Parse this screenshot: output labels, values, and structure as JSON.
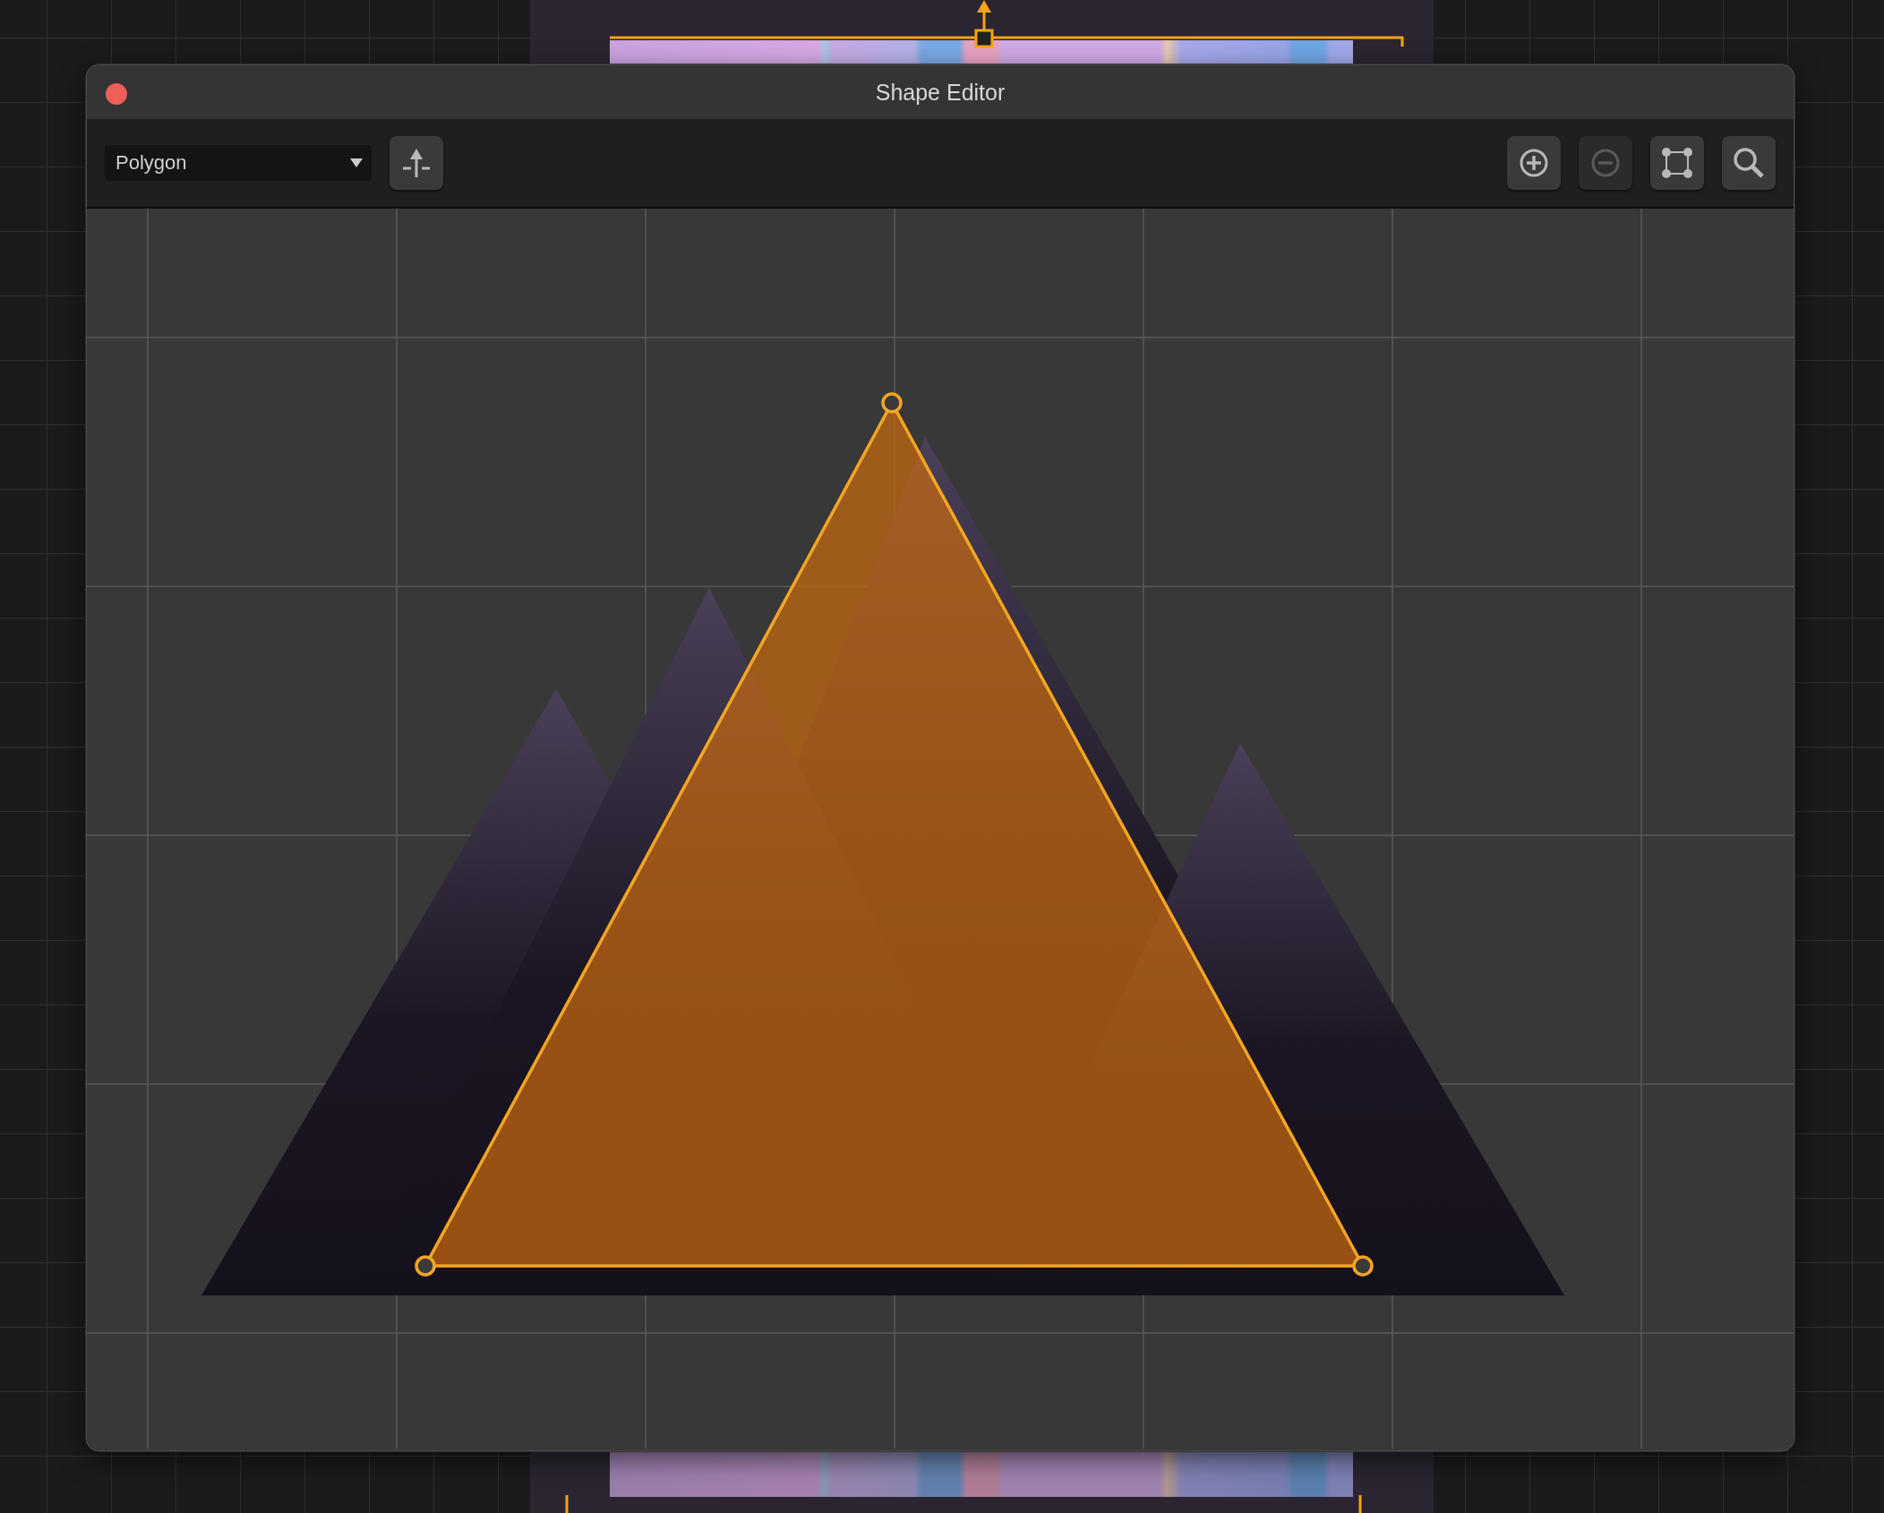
{
  "window": {
    "title": "Shape Editor"
  },
  "toolbar": {
    "shape_type": "Polygon",
    "left_buttons": [
      {
        "kind": "insert-point",
        "disabled": false
      }
    ],
    "right_buttons": [
      {
        "kind": "zoom-in",
        "disabled": false
      },
      {
        "kind": "zoom-out",
        "disabled": true
      },
      {
        "kind": "fit",
        "disabled": false
      },
      {
        "kind": "search",
        "disabled": false
      }
    ]
  }
}
